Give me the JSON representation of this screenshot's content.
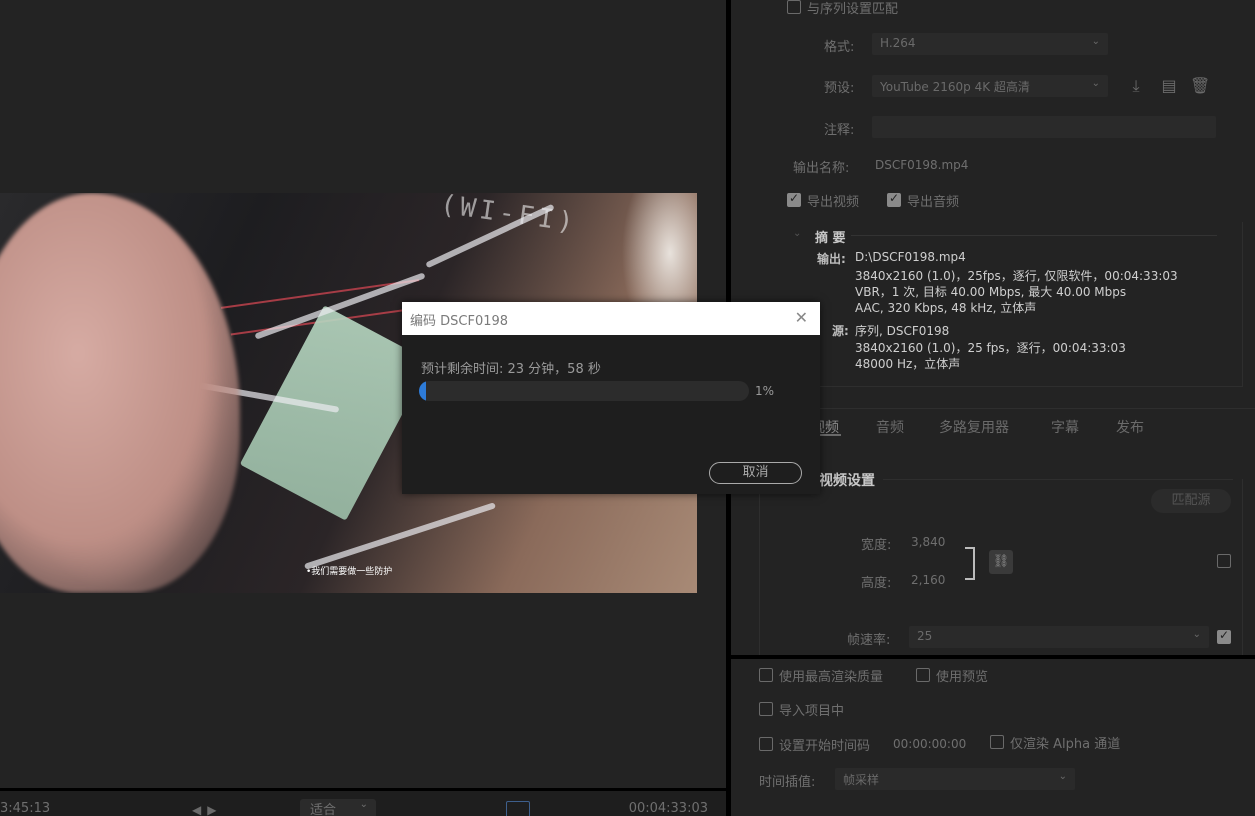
{
  "preview": {
    "subtitle_text": "•我们需要做一些防护",
    "sticker_text": "(WI-FI)"
  },
  "playback": {
    "current_tc": "3:45:13",
    "fit_label": "适合",
    "duration_tc": "00:04:33:03"
  },
  "export": {
    "match_sequence_label": "与序列设置匹配",
    "format_label": "格式:",
    "format_value": "H.264",
    "preset_label": "预设:",
    "preset_value": "YouTube 2160p 4K 超高清",
    "comment_label": "注释:",
    "output_name_label": "输出名称:",
    "output_name_value": "DSCF0198.mp4",
    "export_video_label": "导出视频",
    "export_audio_label": "导出音频",
    "summary_title": "摘 要",
    "summary_output_key": "输出:",
    "summary_output_lines": [
      "D:\\DSCF0198.mp4",
      "3840x2160 (1.0)，25fps，逐行, 仅限软件，00:04:33:03",
      "VBR，1 次, 目标 40.00 Mbps, 最大 40.00 Mbps",
      "AAC, 320 Kbps, 48 kHz, 立体声"
    ],
    "summary_source_key": "源:",
    "summary_source_lines": [
      "序列, DSCF0198",
      "3840x2160 (1.0)，25 fps，逐行，00:04:33:03",
      "48000 Hz，立体声"
    ],
    "tabs": [
      "视频",
      "音频",
      "多路复用器",
      "字幕",
      "发布"
    ],
    "video_settings_title": "视频设置",
    "match_source_button": "匹配源",
    "width_label": "宽度:",
    "width_value": "3,840",
    "height_label": "高度:",
    "height_value": "2,160",
    "frame_rate_label": "帧速率:",
    "frame_rate_value": "25",
    "max_render_label": "使用最高渲染质量",
    "use_previews_label": "使用预览",
    "import_project_label": "导入项目中",
    "set_start_tc_label": "设置开始时间码",
    "start_tc_value": "00:00:00:00",
    "render_alpha_label": "仅渲染 Alpha 通道",
    "time_interp_label": "时间插值:",
    "time_interp_value": "帧采样"
  },
  "dialog": {
    "title": "编码 DSCF0198",
    "eta_text": "预计剩余时间: 23 分钟，58 秒",
    "progress": 1,
    "progress_label": "1%",
    "cancel_label": "取消",
    "accent_color": "#2d7bd8"
  }
}
